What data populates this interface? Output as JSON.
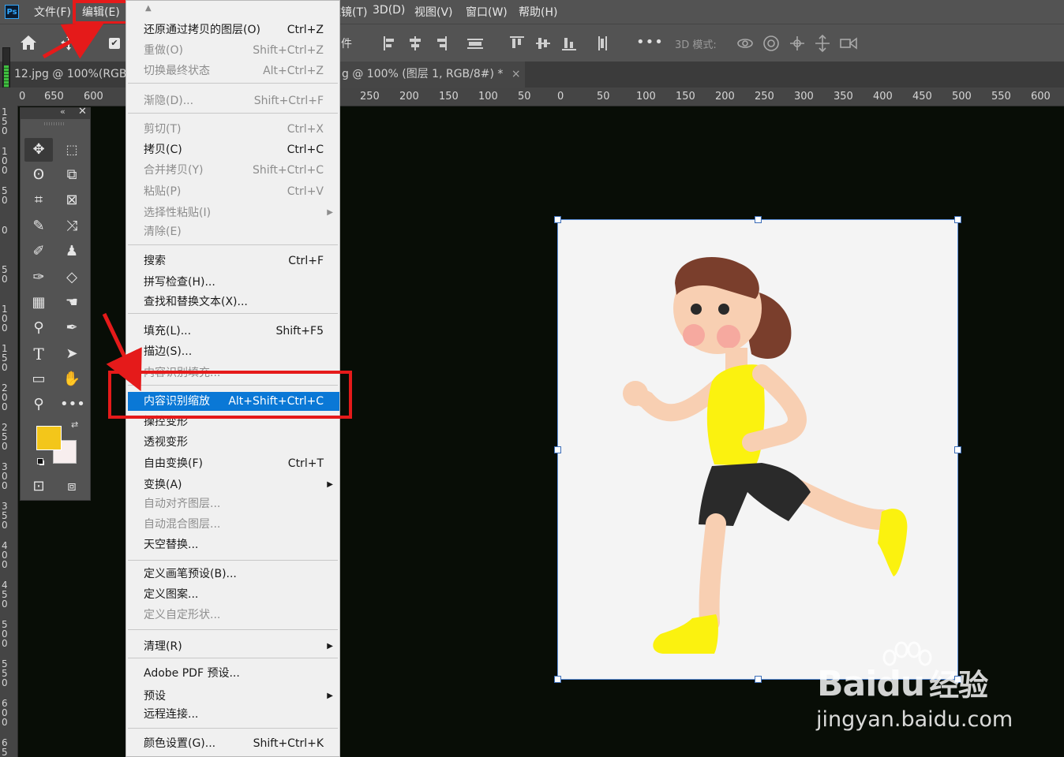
{
  "app": {
    "logo": "Ps"
  },
  "menubar": {
    "items": [
      "文件(F)",
      "编辑(E)",
      "滤镜(T)",
      "3D(D)",
      "视图(V)",
      "窗口(W)",
      "帮助(H)"
    ],
    "visible_fragment": "滤镜(T)"
  },
  "options": {
    "frag": "件",
    "mode3d_label": "3D 模式:"
  },
  "tabs": {
    "tab1": "12.jpg @ 100%(RGB/8",
    "tab2": "g @ 100% (图层 1, RGB/8#) *",
    "close": "×"
  },
  "rulers": {
    "h_left": [
      "0",
      "650",
      "600"
    ],
    "h_right": [
      "250",
      "200",
      "150",
      "100",
      "50",
      "0",
      "50",
      "100",
      "150",
      "200",
      "250",
      "300",
      "350",
      "400",
      "450",
      "500",
      "550",
      "600"
    ],
    "v": [
      "1\n5\n0",
      "1\n0\n0",
      "5\n0",
      "0",
      "5\n0",
      "1\n0\n0",
      "1\n5\n0",
      "2\n0\n0",
      "2\n5\n0",
      "3\n0\n0",
      "3\n5\n0",
      "4\n0\n0",
      "4\n5\n0",
      "5\n0\n0",
      "5\n5\n0",
      "6\n0\n0",
      "6\n5"
    ]
  },
  "colors": {
    "foreground": "#f3c61a",
    "background": "#f7eeee",
    "accent": "#0a78d6",
    "highlight_box": "#e51a1a"
  },
  "editmenu": {
    "items": [
      {
        "label": "还原通过拷贝的图层(O)",
        "shortcut": "Ctrl+Z",
        "disabled": false
      },
      {
        "label": "重做(O)",
        "shortcut": "Shift+Ctrl+Z",
        "disabled": true
      },
      {
        "label": "切换最终状态",
        "shortcut": "Alt+Ctrl+Z",
        "disabled": true
      },
      {
        "label": "渐隐(D)...",
        "shortcut": "Shift+Ctrl+F",
        "disabled": true
      },
      {
        "label": "剪切(T)",
        "shortcut": "Ctrl+X",
        "disabled": true
      },
      {
        "label": "拷贝(C)",
        "shortcut": "Ctrl+C",
        "disabled": false
      },
      {
        "label": "合并拷贝(Y)",
        "shortcut": "Shift+Ctrl+C",
        "disabled": true
      },
      {
        "label": "粘贴(P)",
        "shortcut": "Ctrl+V",
        "disabled": true
      },
      {
        "label": "选择性粘贴(I)",
        "shortcut": "",
        "disabled": true,
        "submenu": true
      },
      {
        "label": "清除(E)",
        "shortcut": "",
        "disabled": true
      },
      {
        "label": "搜索",
        "shortcut": "Ctrl+F",
        "disabled": false
      },
      {
        "label": "拼写检查(H)...",
        "shortcut": "",
        "disabled": false
      },
      {
        "label": "查找和替换文本(X)...",
        "shortcut": "",
        "disabled": false
      },
      {
        "label": "填充(L)...",
        "shortcut": "Shift+F5",
        "disabled": false
      },
      {
        "label": "描边(S)...",
        "shortcut": "",
        "disabled": false
      },
      {
        "label": "内容识别填充...",
        "shortcut": "",
        "disabled": true
      },
      {
        "label": "内容识别缩放",
        "shortcut": "Alt+Shift+Ctrl+C",
        "disabled": false,
        "highlighted": true
      },
      {
        "label": "操控变形",
        "shortcut": "",
        "disabled": false
      },
      {
        "label": "透视变形",
        "shortcut": "",
        "disabled": false
      },
      {
        "label": "自由变换(F)",
        "shortcut": "Ctrl+T",
        "disabled": false
      },
      {
        "label": "变换(A)",
        "shortcut": "",
        "disabled": false,
        "submenu": true
      },
      {
        "label": "自动对齐图层...",
        "shortcut": "",
        "disabled": true
      },
      {
        "label": "自动混合图层...",
        "shortcut": "",
        "disabled": true
      },
      {
        "label": "天空替换...",
        "shortcut": "",
        "disabled": false
      },
      {
        "label": "定义画笔预设(B)...",
        "shortcut": "",
        "disabled": false
      },
      {
        "label": "定义图案...",
        "shortcut": "",
        "disabled": false
      },
      {
        "label": "定义自定形状...",
        "shortcut": "",
        "disabled": true
      },
      {
        "label": "清理(R)",
        "shortcut": "",
        "disabled": false,
        "submenu": true
      },
      {
        "label": "Adobe PDF 预设...",
        "shortcut": "",
        "disabled": false
      },
      {
        "label": "预设",
        "shortcut": "",
        "disabled": false,
        "submenu": true
      },
      {
        "label": "远程连接...",
        "shortcut": "",
        "disabled": false
      },
      {
        "label": "颜色设置(G)...",
        "shortcut": "Shift+Ctrl+K",
        "disabled": false
      }
    ]
  },
  "watermark": {
    "brand": "Bai",
    "brand2": "du",
    "cn": "经验",
    "url": "jingyan.baidu.com"
  }
}
